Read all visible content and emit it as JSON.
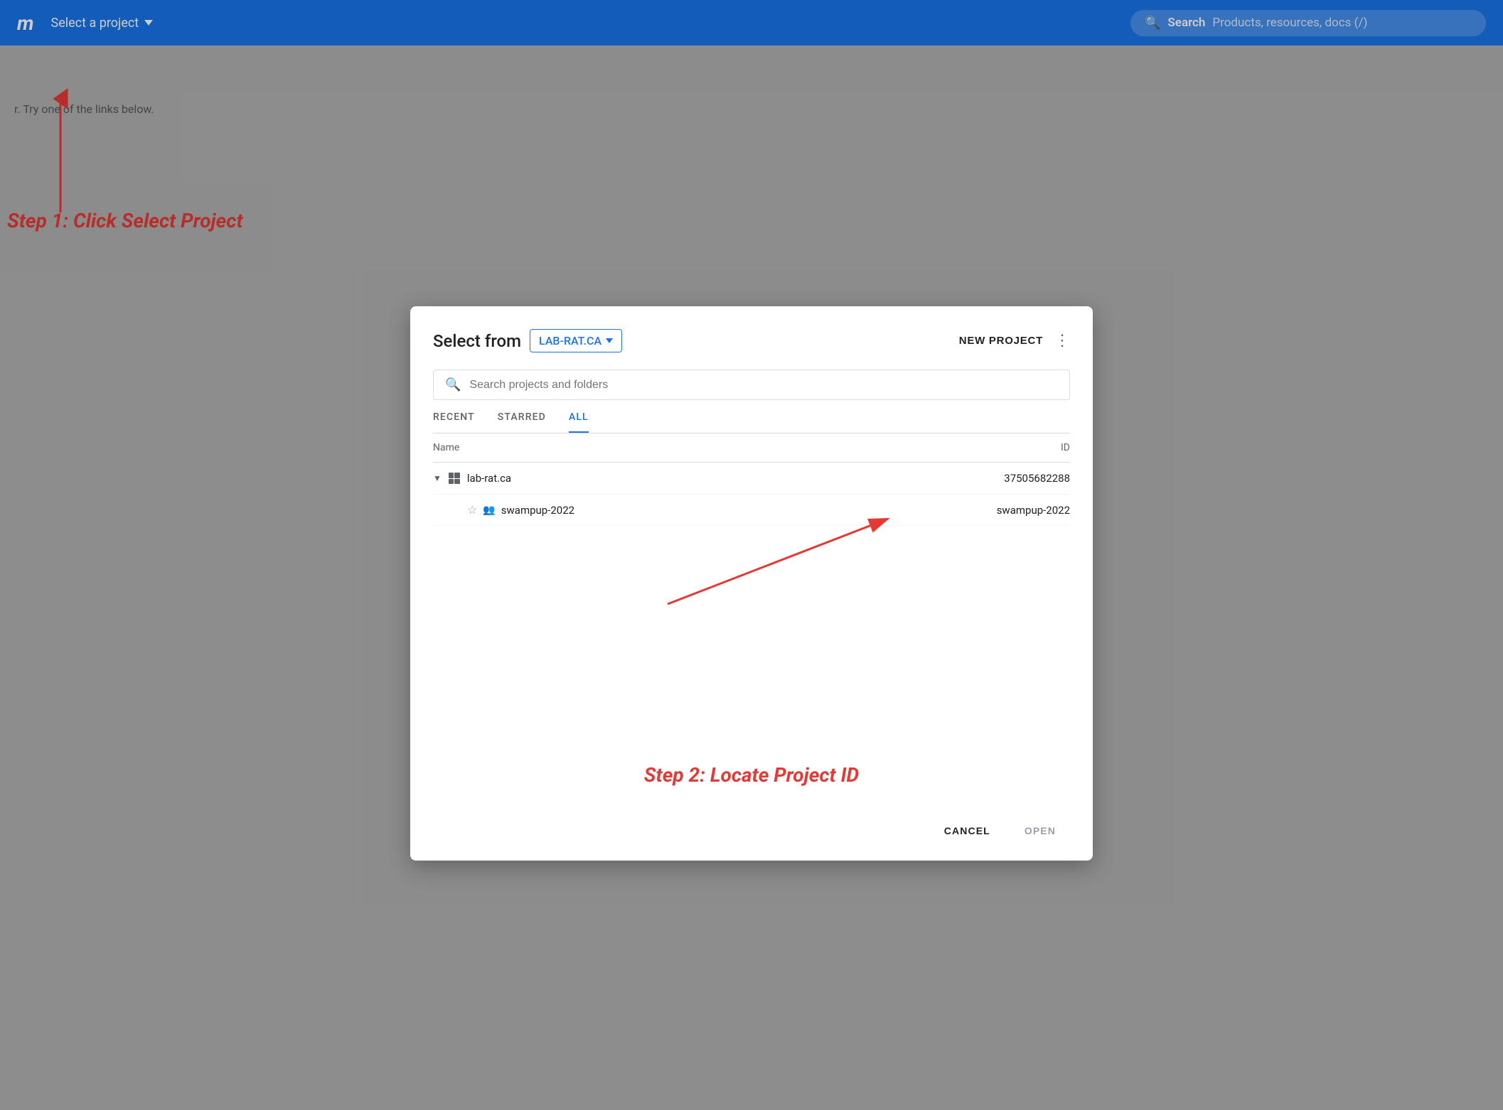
{
  "topbar": {
    "logo": "m",
    "project_selector_label": "Select a project",
    "search_label": "Search",
    "search_placeholder": "Products, resources, docs (/)"
  },
  "background": {
    "text": "r. Try one of the links below."
  },
  "annotations": {
    "step1": "Step 1: Click Select Project",
    "step2": "Step 2: Locate Project ID"
  },
  "modal": {
    "title": "Select from",
    "org_selector_label": "LAB-RAT.CA",
    "new_project_btn": "NEW PROJECT",
    "search_placeholder": "Search projects and folders",
    "tabs": [
      {
        "label": "RECENT",
        "active": false
      },
      {
        "label": "STARRED",
        "active": false
      },
      {
        "label": "ALL",
        "active": true
      }
    ],
    "table": {
      "columns": [
        {
          "label": "Name",
          "key": "name"
        },
        {
          "label": "ID",
          "key": "id",
          "align": "right"
        }
      ],
      "rows": [
        {
          "type": "org",
          "name": "lab-rat.ca",
          "id": "37505682288",
          "expanded": true,
          "level": 0
        },
        {
          "type": "project",
          "name": "swampup-2022",
          "id": "swampup-2022",
          "level": 1,
          "starred": false
        }
      ]
    },
    "footer": {
      "cancel_label": "CANCEL",
      "open_label": "OPEN"
    }
  }
}
